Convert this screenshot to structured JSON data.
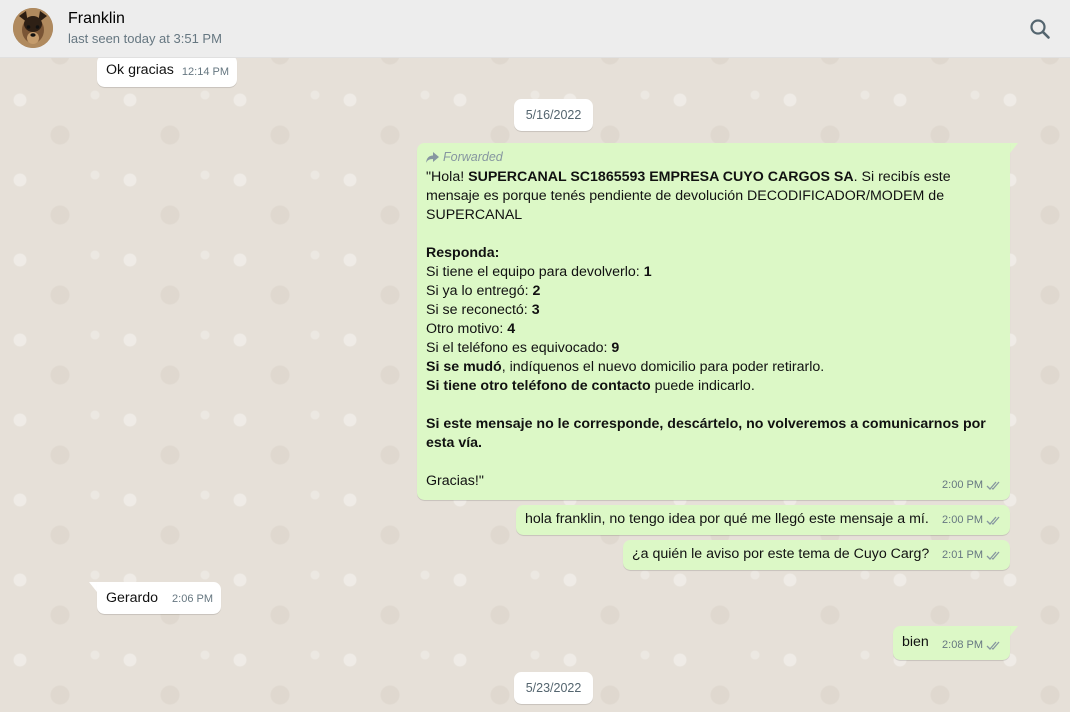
{
  "header": {
    "contact_name": "Franklin",
    "last_seen": "last seen today at 3:51 PM",
    "avatar_icon": "dog-avatar",
    "search_icon": "search-icon"
  },
  "dates": [
    "5/16/2022",
    "5/23/2022"
  ],
  "messages": {
    "m0": {
      "text": "Ok gracias",
      "time": "12:14 PM"
    },
    "m1": {
      "forwarded_label": "Forwarded",
      "l1a": "\"Hola! ",
      "l1b": "SUPERCANAL SC1865593  EMPRESA CUYO CARGOS SA",
      "l1c": ". Si recibís este mensaje es porque tenés pendiente de devolución DECODIFICADOR/MODEM de SUPERCANAL",
      "responda": "Responda:",
      "o1a": "Si tiene el equipo para devolverlo: ",
      "o1b": "1",
      "o2a": "Si ya lo entregó: ",
      "o2b": "2",
      "o3a": "Si se reconectó: ",
      "o3b": "3",
      "o4a": "Otro motivo: ",
      "o4b": "4",
      "o5a": "Si el teléfono es equivocado: ",
      "o5b": "9",
      "o6a": "Si se mudó",
      "o6b": ", indíquenos el nuevo domicilio para poder retirarlo.",
      "o7a": "Si tiene otro teléfono de contacto",
      "o7b": " puede indicarlo.",
      "notice": "Si este mensaje no le corresponde, descártelo, no volveremos a comunicarnos por esta vía.",
      "thanks": "Gracias!\"",
      "time": "2:00 PM"
    },
    "m2": {
      "text": "hola franklin, no tengo idea por qué me llegó este mensaje a mí.",
      "time": "2:00 PM"
    },
    "m3": {
      "text": "¿a quién le aviso por este tema de Cuyo Carg?",
      "time": "2:01 PM"
    },
    "m4": {
      "text": "Gerardo",
      "time": "2:06 PM"
    },
    "m5": {
      "text": "bien",
      "time": "2:08 PM"
    }
  },
  "colors": {
    "outgoing_bubble": "#dcf8c6",
    "incoming_bubble": "#ffffff",
    "header_bg": "#ededed",
    "chat_bg": "#e6e0d8"
  }
}
